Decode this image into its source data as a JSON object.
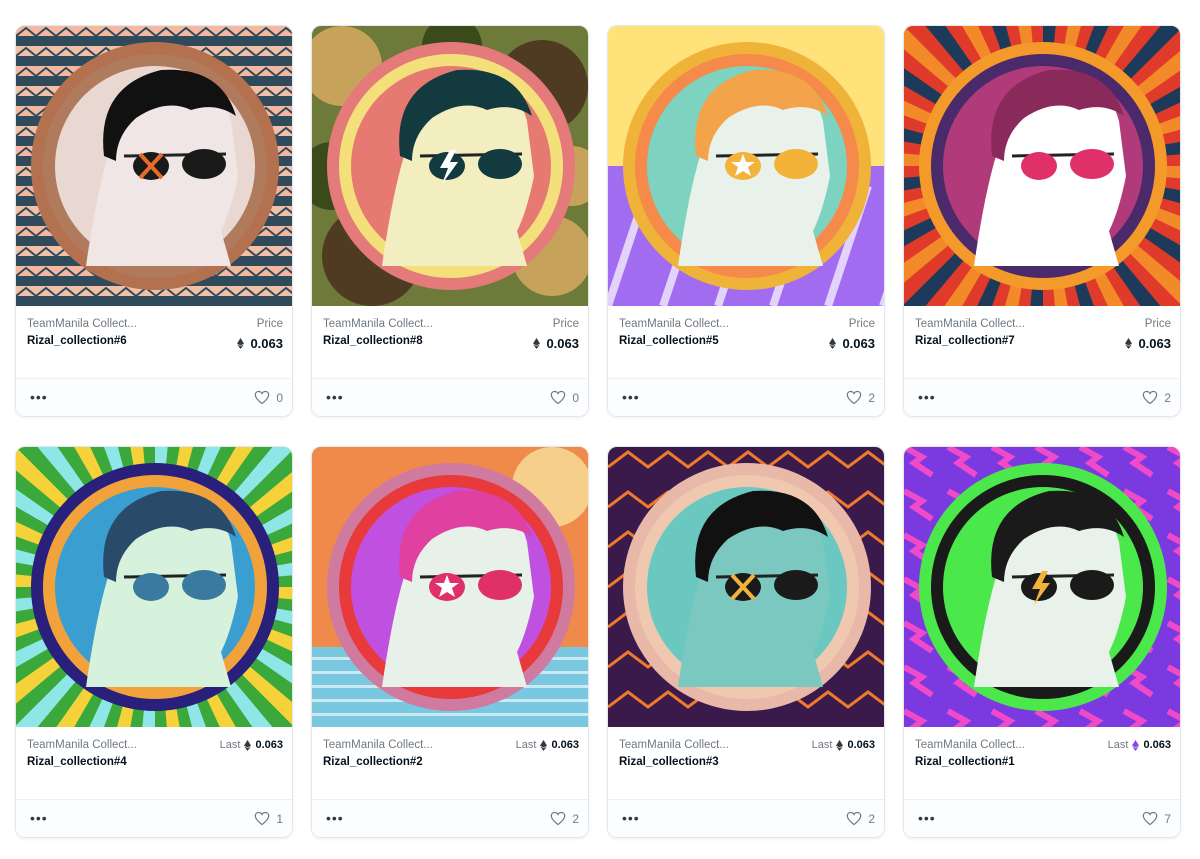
{
  "colors": {
    "border": "#e5e8eb",
    "text": "#04111d",
    "muted": "#707a83",
    "eth": "#353840",
    "eth_polygon": "#8247e5"
  },
  "items": [
    {
      "collection": "TeamManila Collect...",
      "name": "Rizal_collection#6",
      "price_label": "Price",
      "price": "0.063",
      "price_mode": "price",
      "likes": "0",
      "eye": "x-mark"
    },
    {
      "collection": "TeamManila Collect...",
      "name": "Rizal_collection#8",
      "price_label": "Price",
      "price": "0.063",
      "price_mode": "price",
      "likes": "0",
      "eye": "lightning"
    },
    {
      "collection": "TeamManila Collect...",
      "name": "Rizal_collection#5",
      "price_label": "Price",
      "price": "0.063",
      "price_mode": "price",
      "likes": "2",
      "eye": "star"
    },
    {
      "collection": "TeamManila Collect...",
      "name": "Rizal_collection#7",
      "price_label": "Price",
      "price": "0.063",
      "price_mode": "price",
      "likes": "2",
      "eye": "plain"
    },
    {
      "collection": "TeamManila Collect...",
      "name": "Rizal_collection#4",
      "price_label": "Last",
      "price": "0.063",
      "price_mode": "last",
      "likes": "1",
      "eye": "plain"
    },
    {
      "collection": "TeamManila Collect...",
      "name": "Rizal_collection#2",
      "price_label": "Last",
      "price": "0.063",
      "price_mode": "last",
      "likes": "2",
      "eye": "star"
    },
    {
      "collection": "TeamManila Collect...",
      "name": "Rizal_collection#3",
      "price_label": "Last",
      "price": "0.063",
      "price_mode": "last",
      "likes": "2",
      "eye": "x-mark"
    },
    {
      "collection": "TeamManila Collect...",
      "name": "Rizal_collection#1",
      "price_label": "Last",
      "price": "0.063",
      "price_mode": "last",
      "likes": "7",
      "eye": "lightning"
    }
  ]
}
